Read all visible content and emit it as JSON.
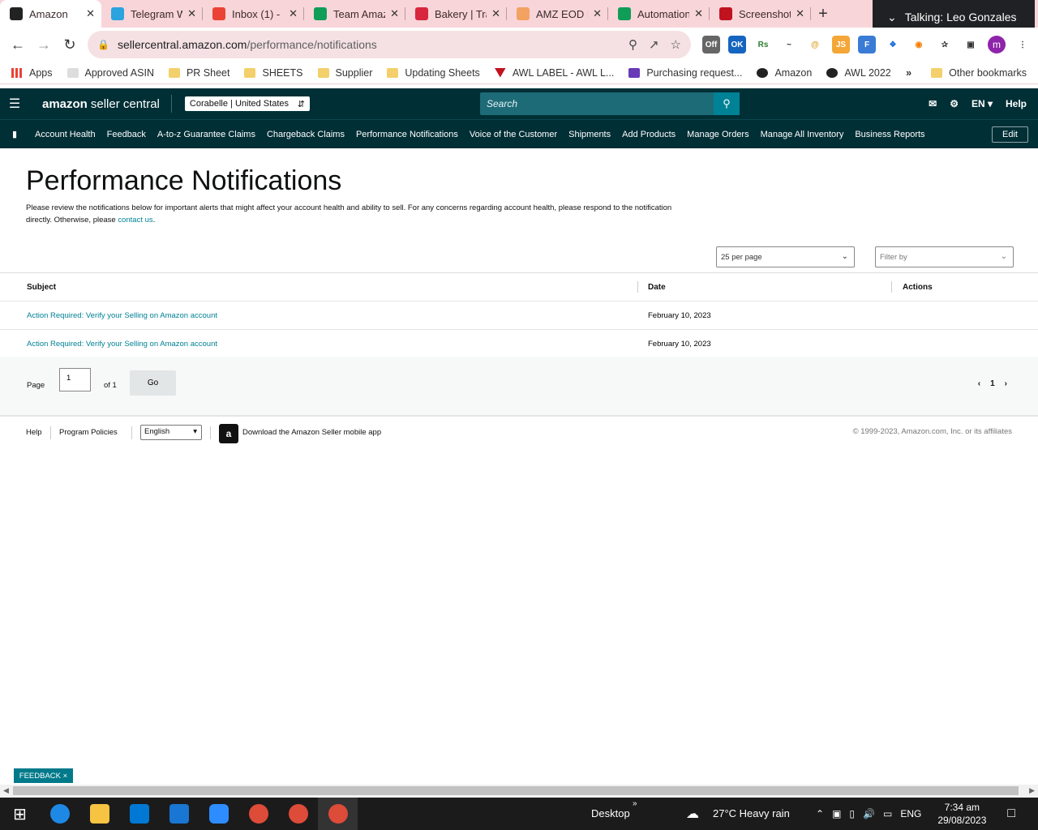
{
  "browser": {
    "tabs": [
      {
        "label": "Amazon",
        "icon": "amazon-a",
        "color": "#222222",
        "active": true
      },
      {
        "label": "Telegram W",
        "icon": "telegram",
        "color": "#2aa3df"
      },
      {
        "label": "Inbox (1) - ",
        "icon": "gmail",
        "color": "#ea4335"
      },
      {
        "label": "Team Amaz",
        "icon": "sheets",
        "color": "#0f9d58"
      },
      {
        "label": "Bakery | Tra",
        "icon": "bakery",
        "color": "#d7263d"
      },
      {
        "label": "AMZ EOD F",
        "icon": "amz-eod",
        "color": "#f4a261"
      },
      {
        "label": "Automation",
        "icon": "sheets",
        "color": "#0f9d58"
      },
      {
        "label": "Screenshot",
        "icon": "screenshot",
        "color": "#c1121f"
      }
    ],
    "talking": "Talking: Leo Gonzales",
    "url_domain": "sellercentral.amazon.com",
    "url_path": "/performance/notifications",
    "profile_initial": "m",
    "bookmarks": [
      {
        "label": "Apps",
        "icon": "apps-grid"
      },
      {
        "label": "Approved ASIN",
        "icon": "asin"
      },
      {
        "label": "PR Sheet",
        "icon": "folder"
      },
      {
        "label": "SHEETS",
        "icon": "folder"
      },
      {
        "label": "Supplier",
        "icon": "folder"
      },
      {
        "label": "Updating Sheets",
        "icon": "folder"
      },
      {
        "label": "AWL LABEL - AWL L...",
        "icon": "awl"
      },
      {
        "label": "Purchasing request...",
        "icon": "form"
      },
      {
        "label": "Amazon",
        "icon": "amazon-a"
      },
      {
        "label": "AWL 2022",
        "icon": "globe"
      }
    ],
    "other_bookmarks": "Other bookmarks"
  },
  "seller": {
    "logo_bold": "amazon",
    "logo_rest": "seller central",
    "store": "Corabelle | United States",
    "search_placeholder": "Search",
    "top_links": {
      "lang": "EN",
      "help": "Help"
    },
    "nav": [
      "Account Health",
      "Feedback",
      "A-to-z Guarantee Claims",
      "Chargeback Claims",
      "Performance Notifications",
      "Voice of the Customer",
      "Shipments",
      "Add Products",
      "Manage Orders",
      "Manage All Inventory",
      "Business Reports"
    ],
    "edit": "Edit"
  },
  "page": {
    "title": "Performance Notifications",
    "desc": "Please review the notifications below for important alerts that might affect your account health and ability to sell. For any concerns regarding account health, please respond to the notification directly. Otherwise, please",
    "desc_link": "contact us",
    "per_page": "25 per page",
    "filter": "Filter by",
    "columns": {
      "subject": "Subject",
      "date": "Date",
      "actions": "Actions"
    },
    "rows": [
      {
        "subject": "Action Required: Verify your Selling on Amazon account",
        "date": "February 10, 2023"
      },
      {
        "subject": "Action Required: Verify your Selling on Amazon account",
        "date": "February 10, 2023"
      }
    ],
    "pager": {
      "page_label": "Page",
      "page_value": "1",
      "of": "of 1",
      "go": "Go",
      "current": "1"
    }
  },
  "footer": {
    "help": "Help",
    "policies": "Program Policies",
    "language": "English",
    "app_text": "Download the Amazon Seller mobile app",
    "copyright": "© 1999-2023, Amazon.com, Inc. or its affiliates"
  },
  "feedback": "FEEDBACK",
  "taskbar": {
    "desktop": "Desktop",
    "weather": "27°C  Heavy rain",
    "lang": "ENG",
    "time": "7:34 am",
    "date": "29/08/2023"
  }
}
